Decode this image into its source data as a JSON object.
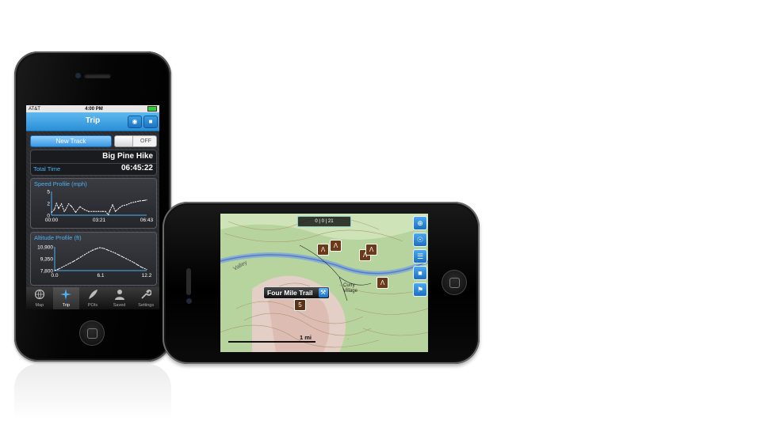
{
  "status_bar": {
    "carrier": "AT&T",
    "time": "4:00 PM"
  },
  "nav": {
    "title": "Trip",
    "camera_icon": "camera-icon",
    "lock_icon": "lock-icon"
  },
  "track": {
    "new_track_label": "New Track",
    "toggle_state": "OFF"
  },
  "trip": {
    "name": "Big Pine Hike",
    "total_time_label": "Total Time",
    "total_time_value": "06:45:22"
  },
  "speed_chart": {
    "title": "Speed Profile (mph)",
    "y_ticks": [
      "5",
      "2",
      "0"
    ],
    "x_ticks": [
      "00:00",
      "03:21",
      "06:43"
    ]
  },
  "altitude_chart": {
    "title": "Altitude Profile (ft)",
    "y_ticks": [
      "10,900",
      "9,350",
      "7,800"
    ],
    "x_ticks": [
      "0.0",
      "6.1",
      "12.2"
    ]
  },
  "chart_data": [
    {
      "type": "line",
      "title": "Speed Profile (mph)",
      "x_ticks": [
        "00:00",
        "03:21",
        "06:43"
      ],
      "ylim": [
        0,
        5
      ],
      "x": [
        0,
        0.2,
        0.35,
        0.5,
        0.7,
        0.9,
        1.0,
        1.2,
        1.4,
        1.7,
        2.0,
        2.3,
        2.6,
        3.0,
        3.3,
        3.6,
        3.8,
        4.0,
        4.1,
        4.3,
        4.5,
        4.8,
        5.0,
        5.3,
        5.6,
        5.9,
        6.2,
        6.5,
        6.7
      ],
      "values": [
        0.6,
        1.2,
        2.5,
        1.4,
        2.4,
        0.8,
        1.2,
        2.4,
        1.9,
        0.6,
        1.8,
        1.2,
        0.8,
        0.8,
        0.8,
        0.8,
        0.8,
        0.1,
        0.9,
        2.2,
        0.8,
        1.6,
        2.0,
        2.2,
        2.6,
        2.8,
        3.0,
        3.1,
        3.2
      ]
    },
    {
      "type": "line",
      "title": "Altitude Profile (ft)",
      "ylim": [
        7800,
        10900
      ],
      "x": [
        0,
        0.5,
        1,
        1.5,
        2,
        2.5,
        3,
        3.5,
        4,
        4.5,
        5,
        5.5,
        6,
        6.5,
        7,
        7.5,
        8,
        8.5,
        9,
        9.5,
        10,
        10.5,
        11,
        11.5,
        12.2
      ],
      "values": [
        7800,
        8000,
        8250,
        8500,
        8750,
        9000,
        9300,
        9600,
        9900,
        10200,
        10450,
        10650,
        10800,
        10700,
        10500,
        10300,
        10100,
        9850,
        9600,
        9350,
        9100,
        8850,
        8550,
        8250,
        7950
      ]
    }
  ],
  "tabs": [
    {
      "label": "Map",
      "icon": "globe-icon"
    },
    {
      "label": "Trip",
      "icon": "compass-rose-icon"
    },
    {
      "label": "POIs",
      "icon": "feather-icon"
    },
    {
      "label": "Saved",
      "icon": "person-icon"
    },
    {
      "label": "Settings",
      "icon": "wrench-icon"
    }
  ],
  "map": {
    "trail_callout": "Four Mile Trail",
    "scale_label": "1 mi",
    "toolbar_text": "0 | 0 | 21",
    "side_buttons": [
      "crosshair-icon",
      "globe-icon",
      "layers-icon",
      "lock-icon",
      "flag-icon"
    ],
    "place_labels": [
      "Curry Village",
      "Valley"
    ],
    "trail_marker": "5"
  },
  "colors": {
    "accent_blue": "#2a8fd8",
    "chart_title_blue": "#4fb0f0",
    "poi_brown": "#6b3a1a"
  }
}
